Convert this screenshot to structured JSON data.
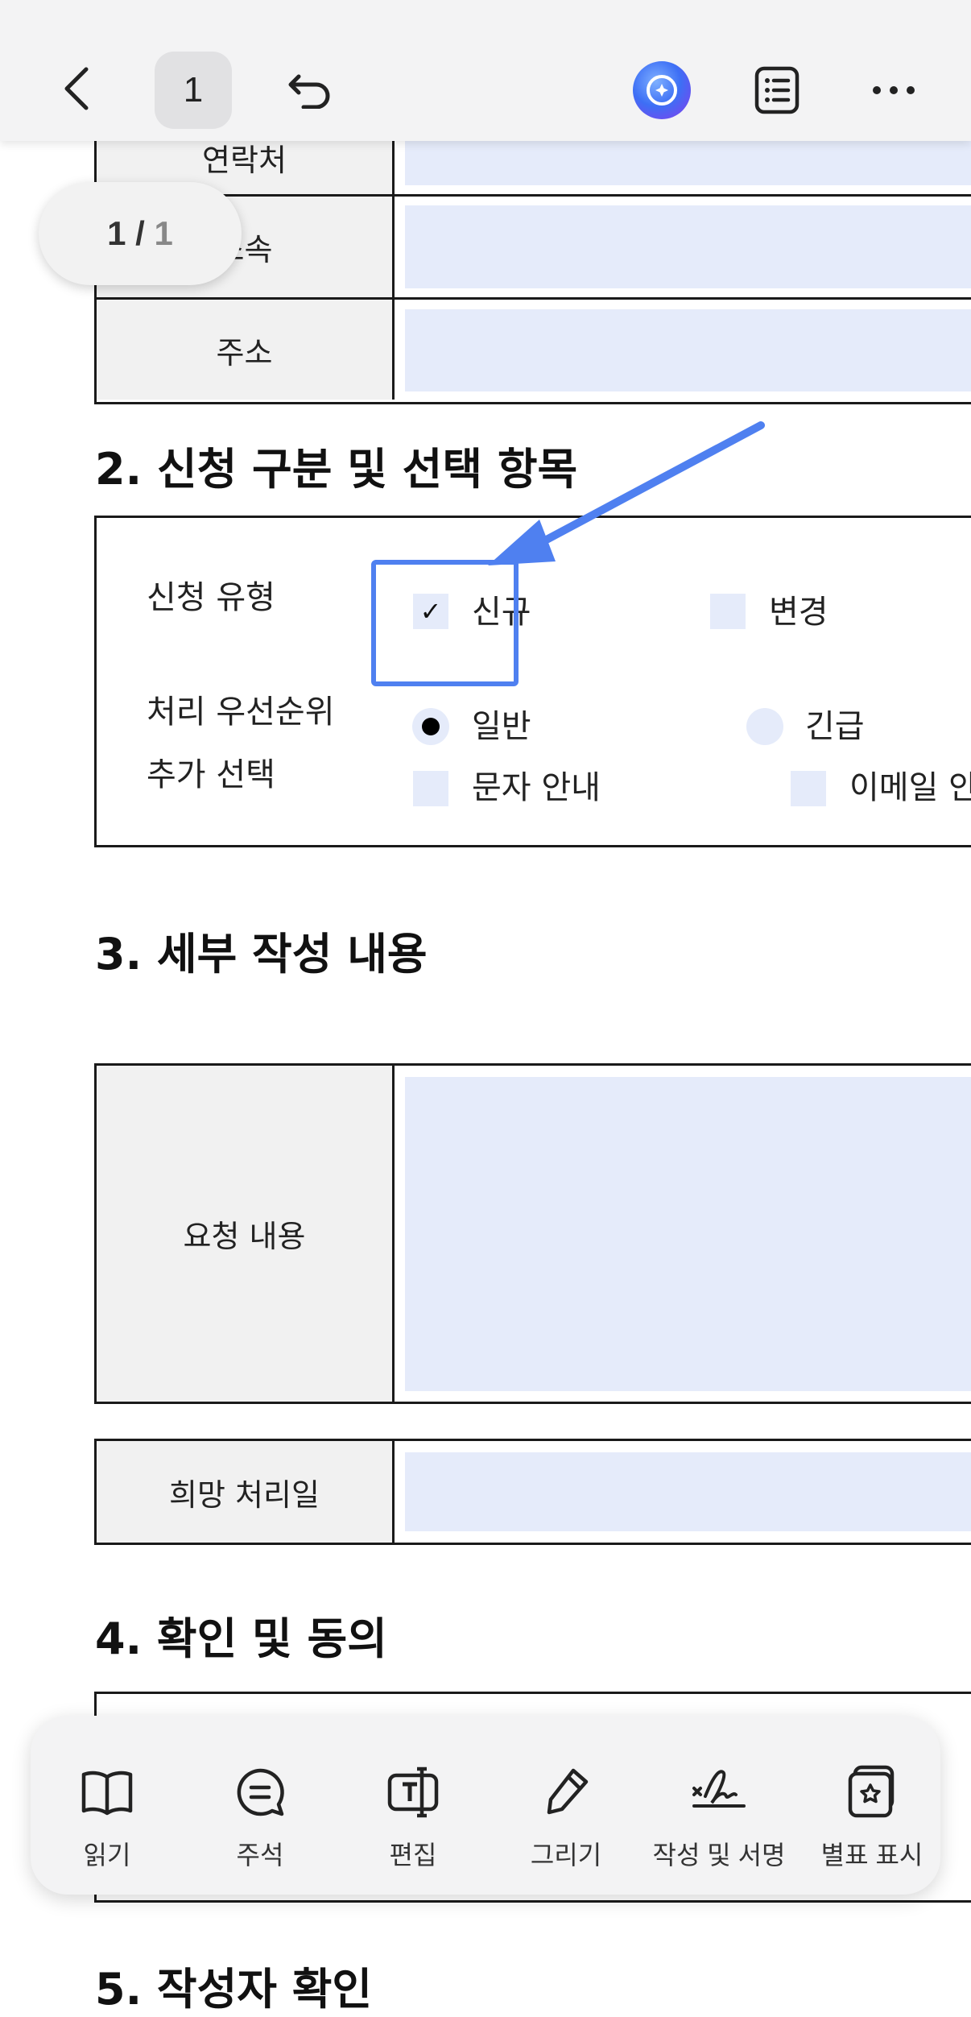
{
  "topbar": {
    "page_number": "1",
    "back_icon": "chevron-left-icon",
    "undo_icon": "undo-icon",
    "ai_icon": "ai-assistant-icon",
    "list_icon": "outline-list-icon",
    "more_icon": "more-icon"
  },
  "page_indicator": {
    "current": "1",
    "separator": " / ",
    "total": "1"
  },
  "section1": {
    "row_labels": [
      "연락처",
      "소속",
      "주소"
    ]
  },
  "section2": {
    "title": "2. 신청 구분 및 선택 항목",
    "type_label": "신청 유형",
    "type_options": [
      "신규",
      "변경"
    ],
    "priority_label": "처리 우선순위",
    "priority_options": [
      "일반",
      "긴급"
    ],
    "extra_label": "추가 선택",
    "extra_options": [
      "문자 안내",
      "이메일 안내"
    ],
    "checked_option": "신규",
    "selected_radio": "일반"
  },
  "section3": {
    "title": "3. 세부 작성 내용",
    "request_label": "요청 내용",
    "date_label": "희망 처리일"
  },
  "section4": {
    "title": "4. 확인 및 동의"
  },
  "section5": {
    "title": "5. 작성자 확인"
  },
  "toolbar": {
    "items": [
      {
        "label": "읽기",
        "icon": "book-icon"
      },
      {
        "label": "주석",
        "icon": "comment-icon"
      },
      {
        "label": "편집",
        "icon": "text-edit-icon"
      },
      {
        "label": "그리기",
        "icon": "pen-icon"
      },
      {
        "label": "작성 및 서명",
        "icon": "signature-icon"
      },
      {
        "label": "별표 표시",
        "icon": "star-bookmark-icon"
      }
    ]
  },
  "colors": {
    "field_fill": "#e5ebfa",
    "annotation_blue": "#4f80f0",
    "bar_bg": "#f3f3f4"
  }
}
